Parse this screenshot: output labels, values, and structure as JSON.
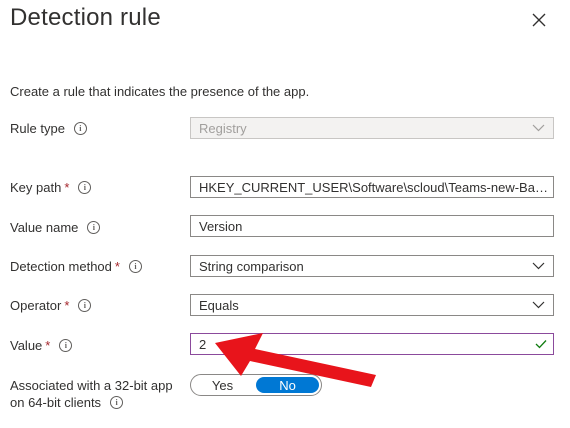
{
  "panel": {
    "title": "Detection rule",
    "description": "Create a rule that indicates the presence of the app."
  },
  "fields": {
    "rule_type": {
      "label": "Rule type",
      "value": "Registry"
    },
    "key_path": {
      "label": "Key path",
      "required": "*",
      "value": "HKEY_CURRENT_USER\\Software\\scloud\\Teams-new-Backg..."
    },
    "value_name": {
      "label": "Value name",
      "value": "Version"
    },
    "detection_method": {
      "label": "Detection method",
      "required": "*",
      "value": "String comparison"
    },
    "operator": {
      "label": "Operator",
      "required": "*",
      "value": "Equals"
    },
    "value": {
      "label": "Value",
      "required": "*",
      "value": "2"
    }
  },
  "association": {
    "label_line1": "Associated with a 32-bit app",
    "label_line2": "on 64-bit clients",
    "options": {
      "yes": "Yes",
      "no": "No"
    },
    "selected": "No"
  },
  "icons": {
    "close": "close-icon",
    "info": "info-icon",
    "chevron": "chevron-down-icon",
    "check": "checkmark-icon",
    "annotation": "red-arrow"
  },
  "colors": {
    "accent": "#0078d4",
    "required": "#a4262c",
    "valid_check": "#107c10",
    "annotation_arrow": "#e8141b"
  }
}
